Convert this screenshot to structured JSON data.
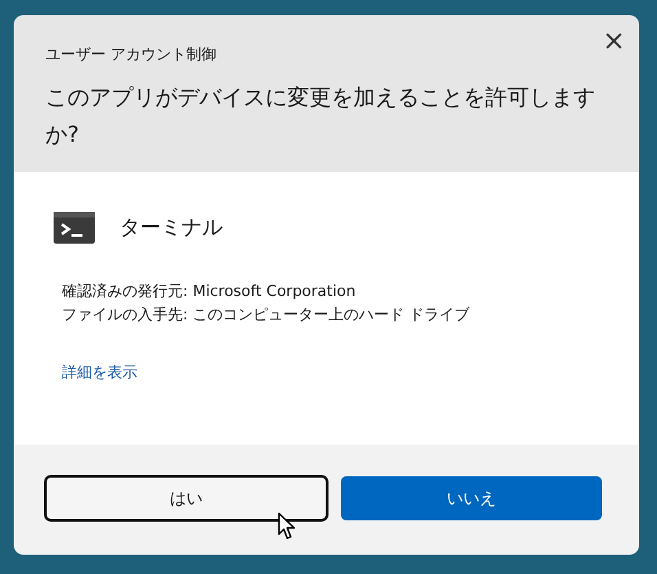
{
  "window": {
    "title": "ユーザー アカウント制御",
    "close": "×"
  },
  "heading": "このアプリがデバイスに変更を加えることを許可しますか?",
  "app": {
    "name": "ターミナル"
  },
  "details": [
    "確認済みの発行元: Microsoft Corporation",
    "ファイルの入手先: このコンピューター上のハード ドライブ"
  ],
  "link": "詳細を表示",
  "buttons": [
    {
      "label": "はい",
      "kind": "default",
      "focused": true
    },
    {
      "label": "いいえ",
      "kind": "primary",
      "focused": false
    }
  ]
}
